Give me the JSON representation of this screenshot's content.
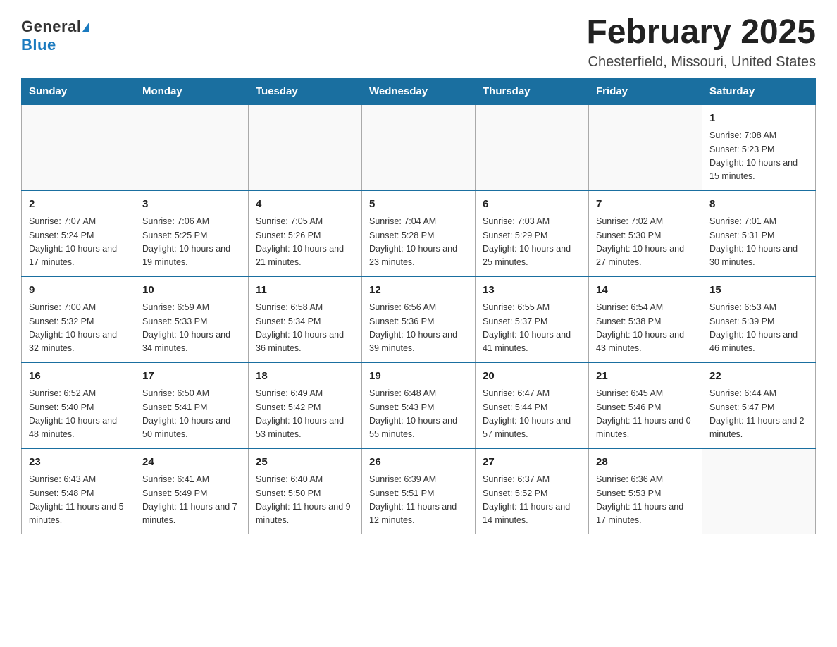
{
  "logo": {
    "general": "General",
    "blue": "Blue"
  },
  "title": "February 2025",
  "location": "Chesterfield, Missouri, United States",
  "days_of_week": [
    "Sunday",
    "Monday",
    "Tuesday",
    "Wednesday",
    "Thursday",
    "Friday",
    "Saturday"
  ],
  "weeks": [
    [
      {
        "day": "",
        "info": ""
      },
      {
        "day": "",
        "info": ""
      },
      {
        "day": "",
        "info": ""
      },
      {
        "day": "",
        "info": ""
      },
      {
        "day": "",
        "info": ""
      },
      {
        "day": "",
        "info": ""
      },
      {
        "day": "1",
        "info": "Sunrise: 7:08 AM\nSunset: 5:23 PM\nDaylight: 10 hours and 15 minutes."
      }
    ],
    [
      {
        "day": "2",
        "info": "Sunrise: 7:07 AM\nSunset: 5:24 PM\nDaylight: 10 hours and 17 minutes."
      },
      {
        "day": "3",
        "info": "Sunrise: 7:06 AM\nSunset: 5:25 PM\nDaylight: 10 hours and 19 minutes."
      },
      {
        "day": "4",
        "info": "Sunrise: 7:05 AM\nSunset: 5:26 PM\nDaylight: 10 hours and 21 minutes."
      },
      {
        "day": "5",
        "info": "Sunrise: 7:04 AM\nSunset: 5:28 PM\nDaylight: 10 hours and 23 minutes."
      },
      {
        "day": "6",
        "info": "Sunrise: 7:03 AM\nSunset: 5:29 PM\nDaylight: 10 hours and 25 minutes."
      },
      {
        "day": "7",
        "info": "Sunrise: 7:02 AM\nSunset: 5:30 PM\nDaylight: 10 hours and 27 minutes."
      },
      {
        "day": "8",
        "info": "Sunrise: 7:01 AM\nSunset: 5:31 PM\nDaylight: 10 hours and 30 minutes."
      }
    ],
    [
      {
        "day": "9",
        "info": "Sunrise: 7:00 AM\nSunset: 5:32 PM\nDaylight: 10 hours and 32 minutes."
      },
      {
        "day": "10",
        "info": "Sunrise: 6:59 AM\nSunset: 5:33 PM\nDaylight: 10 hours and 34 minutes."
      },
      {
        "day": "11",
        "info": "Sunrise: 6:58 AM\nSunset: 5:34 PM\nDaylight: 10 hours and 36 minutes."
      },
      {
        "day": "12",
        "info": "Sunrise: 6:56 AM\nSunset: 5:36 PM\nDaylight: 10 hours and 39 minutes."
      },
      {
        "day": "13",
        "info": "Sunrise: 6:55 AM\nSunset: 5:37 PM\nDaylight: 10 hours and 41 minutes."
      },
      {
        "day": "14",
        "info": "Sunrise: 6:54 AM\nSunset: 5:38 PM\nDaylight: 10 hours and 43 minutes."
      },
      {
        "day": "15",
        "info": "Sunrise: 6:53 AM\nSunset: 5:39 PM\nDaylight: 10 hours and 46 minutes."
      }
    ],
    [
      {
        "day": "16",
        "info": "Sunrise: 6:52 AM\nSunset: 5:40 PM\nDaylight: 10 hours and 48 minutes."
      },
      {
        "day": "17",
        "info": "Sunrise: 6:50 AM\nSunset: 5:41 PM\nDaylight: 10 hours and 50 minutes."
      },
      {
        "day": "18",
        "info": "Sunrise: 6:49 AM\nSunset: 5:42 PM\nDaylight: 10 hours and 53 minutes."
      },
      {
        "day": "19",
        "info": "Sunrise: 6:48 AM\nSunset: 5:43 PM\nDaylight: 10 hours and 55 minutes."
      },
      {
        "day": "20",
        "info": "Sunrise: 6:47 AM\nSunset: 5:44 PM\nDaylight: 10 hours and 57 minutes."
      },
      {
        "day": "21",
        "info": "Sunrise: 6:45 AM\nSunset: 5:46 PM\nDaylight: 11 hours and 0 minutes."
      },
      {
        "day": "22",
        "info": "Sunrise: 6:44 AM\nSunset: 5:47 PM\nDaylight: 11 hours and 2 minutes."
      }
    ],
    [
      {
        "day": "23",
        "info": "Sunrise: 6:43 AM\nSunset: 5:48 PM\nDaylight: 11 hours and 5 minutes."
      },
      {
        "day": "24",
        "info": "Sunrise: 6:41 AM\nSunset: 5:49 PM\nDaylight: 11 hours and 7 minutes."
      },
      {
        "day": "25",
        "info": "Sunrise: 6:40 AM\nSunset: 5:50 PM\nDaylight: 11 hours and 9 minutes."
      },
      {
        "day": "26",
        "info": "Sunrise: 6:39 AM\nSunset: 5:51 PM\nDaylight: 11 hours and 12 minutes."
      },
      {
        "day": "27",
        "info": "Sunrise: 6:37 AM\nSunset: 5:52 PM\nDaylight: 11 hours and 14 minutes."
      },
      {
        "day": "28",
        "info": "Sunrise: 6:36 AM\nSunset: 5:53 PM\nDaylight: 11 hours and 17 minutes."
      },
      {
        "day": "",
        "info": ""
      }
    ]
  ]
}
